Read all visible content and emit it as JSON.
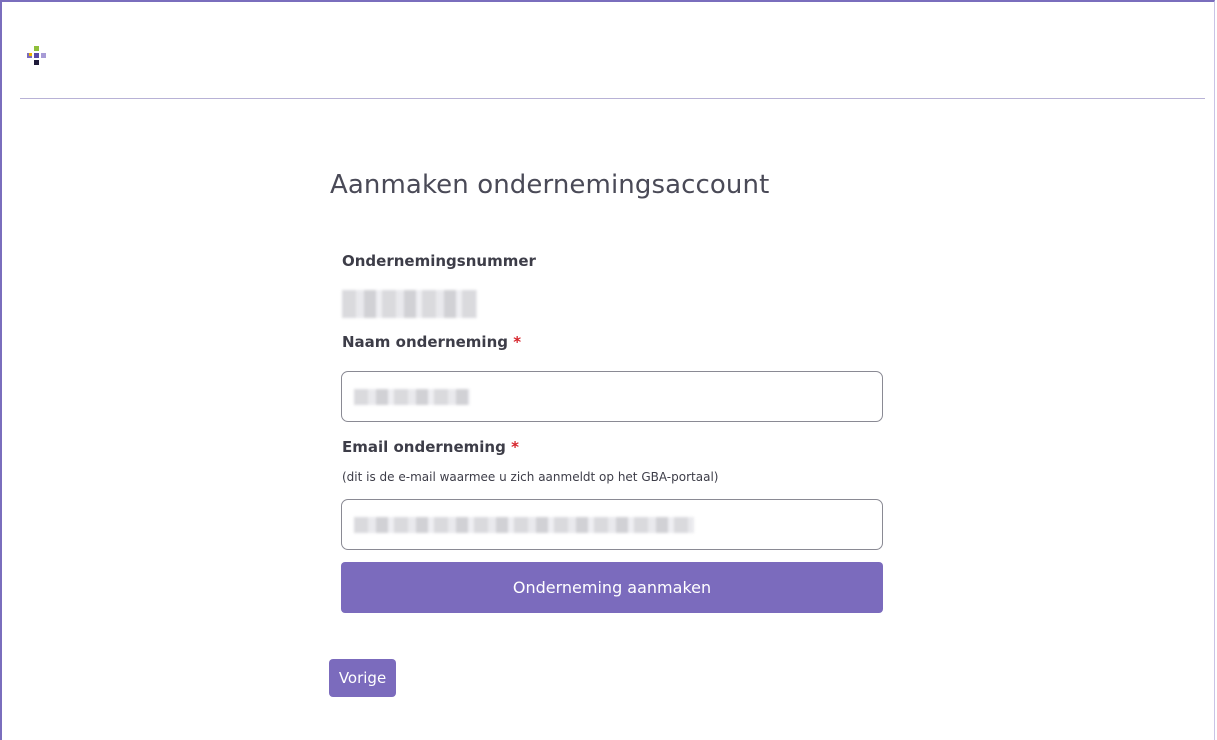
{
  "brand": {
    "logo": "gba-logo-icon",
    "colors": {
      "accent": "#7b6bbd",
      "required": "#d6232a",
      "border": "#7a6ebd"
    }
  },
  "page": {
    "title": "Aanmaken ondernemingsaccount"
  },
  "form": {
    "company_number": {
      "label": "Ondernemingsnummer",
      "value": ""
    },
    "company_name": {
      "label": "Naam onderneming",
      "required_marker": "*",
      "value": ""
    },
    "company_email": {
      "label": "Email onderneming",
      "required_marker": "*",
      "help": "(dit is de e-mail waarmee u zich aanmeldt op het GBA-portaal)",
      "value": ""
    },
    "submit_label": "Onderneming aanmaken"
  },
  "navigation": {
    "back_label": "Vorige"
  }
}
